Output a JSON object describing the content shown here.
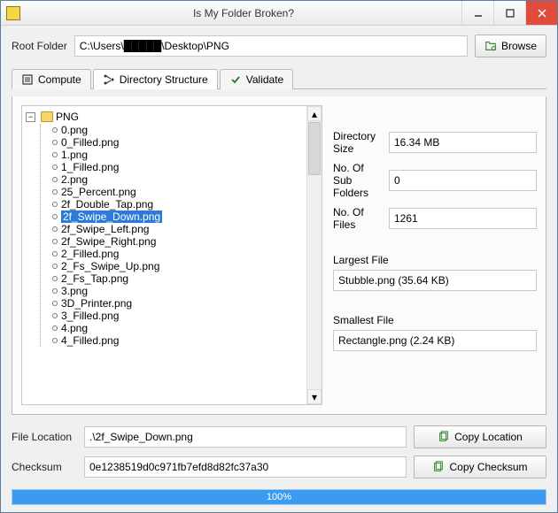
{
  "window": {
    "title": "Is My Folder Broken?"
  },
  "toolbar": {
    "root_folder_label": "Root Folder",
    "root_folder_value": "C:\\Users\\█████\\Desktop\\PNG",
    "browse_label": "Browse"
  },
  "tabs": {
    "compute": "Compute",
    "directory_structure": "Directory Structure",
    "validate": "Validate"
  },
  "tree": {
    "root": "PNG",
    "items": [
      "0.png",
      "0_Filled.png",
      "1.png",
      "1_Filled.png",
      "2.png",
      "25_Percent.png",
      "2f_Double_Tap.png",
      "2f_Swipe_Down.png",
      "2f_Swipe_Left.png",
      "2f_Swipe_Right.png",
      "2_Filled.png",
      "2_Fs_Swipe_Up.png",
      "2_Fs_Tap.png",
      "3.png",
      "3D_Printer.png",
      "3_Filled.png",
      "4.png",
      "4_Filled.png"
    ],
    "selected_index": 7
  },
  "info": {
    "dir_size_label": "Directory Size",
    "dir_size_value": "16.34 MB",
    "subfolders_label": "No. Of Sub Folders",
    "subfolders_value": "0",
    "files_label": "No. Of Files",
    "files_value": "1261",
    "largest_label": "Largest File",
    "largest_value": "Stubble.png (35.64 KB)",
    "smallest_label": "Smallest File",
    "smallest_value": "Rectangle.png (2.24 KB)"
  },
  "footer": {
    "file_location_label": "File Location",
    "file_location_value": ".\\2f_Swipe_Down.png",
    "copy_location_label": "Copy Location",
    "checksum_label": "Checksum",
    "checksum_value": "0e1238519d0c971fb7efd8d82fc37a30",
    "copy_checksum_label": "Copy Checksum"
  },
  "progress": {
    "percent_text": "100%",
    "percent": 100
  }
}
